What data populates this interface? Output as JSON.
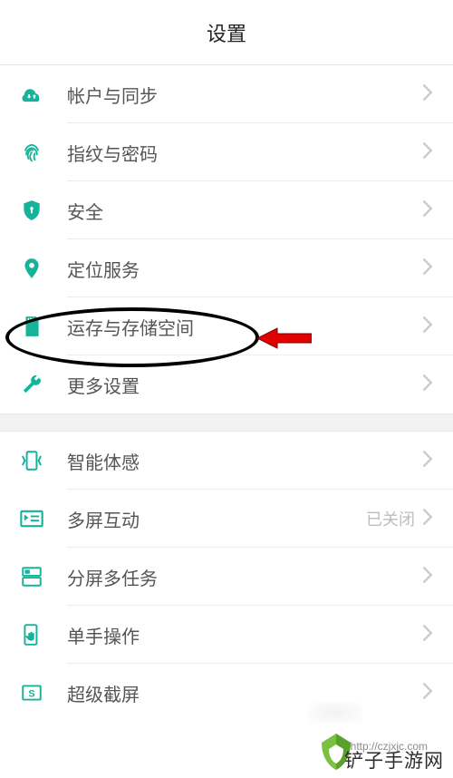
{
  "header": {
    "title": "设置"
  },
  "sections": [
    {
      "rows": [
        {
          "key": "account-sync",
          "icon": "cloud-sync-icon",
          "label": "帐户与同步"
        },
        {
          "key": "fingerprint-password",
          "icon": "fingerprint-icon",
          "label": "指纹与密码"
        },
        {
          "key": "security",
          "icon": "shield-icon",
          "label": "安全"
        },
        {
          "key": "location",
          "icon": "location-icon",
          "label": "定位服务"
        },
        {
          "key": "storage",
          "icon": "sd-card-icon",
          "label": "运存与存储空间"
        },
        {
          "key": "more-settings",
          "icon": "wrench-icon",
          "label": "更多设置"
        }
      ]
    },
    {
      "rows": [
        {
          "key": "smart-motion",
          "icon": "motion-icon",
          "label": "智能体感"
        },
        {
          "key": "multi-screen",
          "icon": "multiscreen-icon",
          "label": "多屏互动",
          "meta": "已关闭"
        },
        {
          "key": "split-screen",
          "icon": "split-icon",
          "label": "分屏多任务"
        },
        {
          "key": "one-hand",
          "icon": "onehand-icon",
          "label": "单手操作"
        },
        {
          "key": "super-screenshot",
          "icon": "screenshot-icon",
          "label": "超级截屏"
        }
      ]
    }
  ],
  "accent": "#14b39a",
  "watermark": {
    "text": "铲子手游网",
    "url": "http://czjxjc.com"
  }
}
